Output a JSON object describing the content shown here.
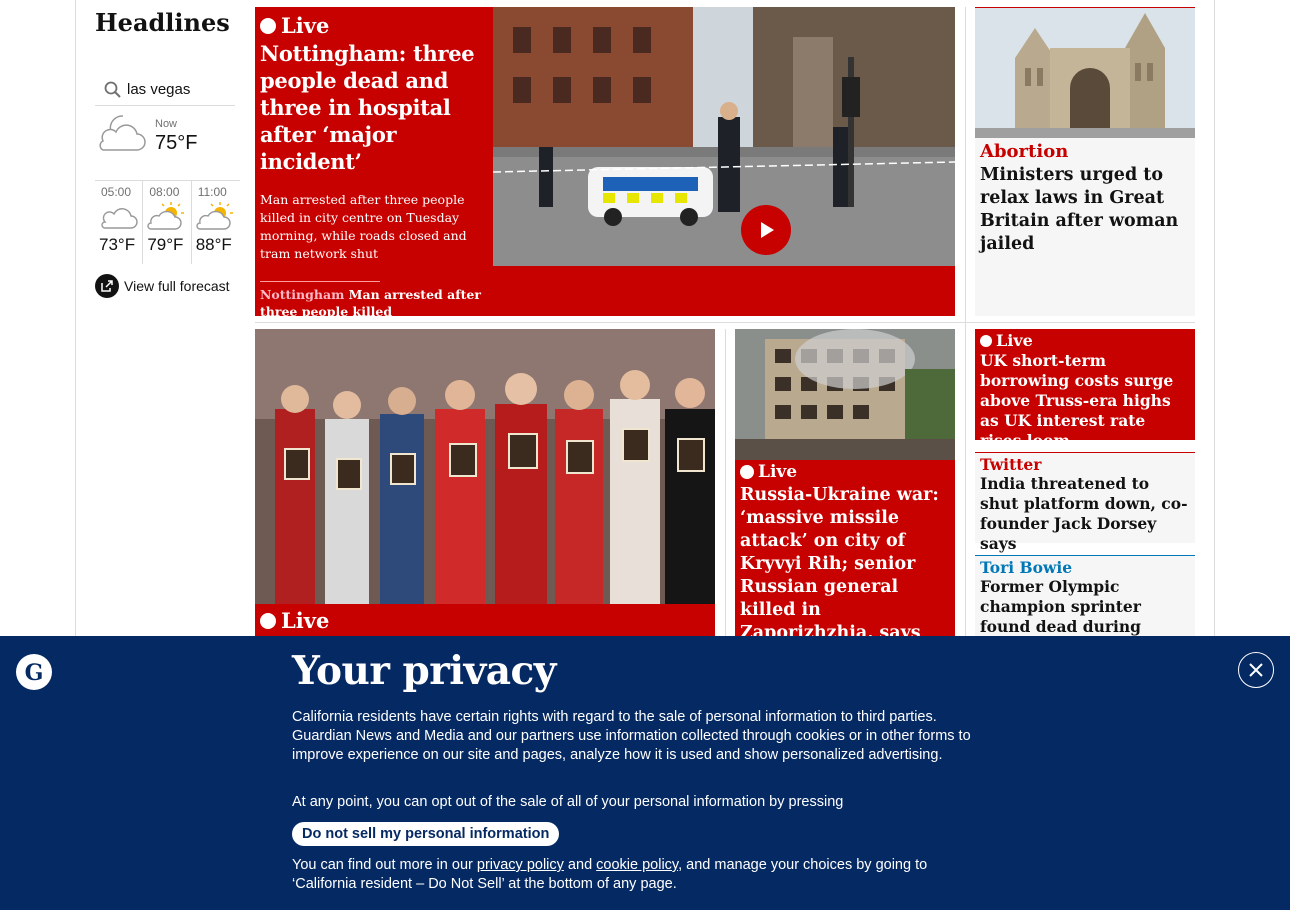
{
  "sidebar": {
    "title": "Headlines",
    "location": "las vegas",
    "now_label": "Now",
    "now_temp": "75°F",
    "forecast": [
      {
        "time": "05:00",
        "temp": "73°F",
        "icon": "cloud-icon"
      },
      {
        "time": "08:00",
        "temp": "79°F",
        "icon": "sun-cloud-icon"
      },
      {
        "time": "11:00",
        "temp": "88°F",
        "icon": "sun-cloud-icon"
      }
    ],
    "full_forecast": "View full forecast"
  },
  "lead": {
    "live": "Live",
    "headline": "Nottingham: three people dead and three in hospital after ‘major incident’",
    "standfirst": "Man arrested after three people killed in city centre on Tuesday morning, while roads closed and tram network shut",
    "sub_kicker": "Nottingham",
    "sub_text": "Man arrested after three people killed"
  },
  "court": {
    "kicker": "Abortion",
    "headline": "Ministers urged to relax laws in Great Britain after woman jailed"
  },
  "nurses": {
    "live": "Live"
  },
  "ukraine": {
    "live": "Live",
    "headline": "Russia-Ukraine war: ‘massive missile attack’ on city of Kryvyi Rih; senior Russian general killed in Zaporizhzhia, says Moscow"
  },
  "borrow": {
    "live": "Live",
    "headline": "UK short-term borrowing costs surge above Truss-era highs as UK interest rate rises loom"
  },
  "twitter": {
    "kicker": "Twitter",
    "headline": "India threatened to shut platform down, co-founder Jack Dorsey says"
  },
  "bowie": {
    "kicker": "Tori Bowie",
    "headline": "Former Olympic champion sprinter found dead during childbirth at home"
  },
  "privacy": {
    "title": "Your privacy",
    "p1": "California residents have certain rights with regard to the sale of personal information to third parties. Guardian News and Media and our partners use information collected through cookies or in other forms to improve experience on our site and pages, analyze how it is used and show personalized advertising.",
    "p2": "At any point, you can opt out of the sale of all of your personal information by pressing",
    "button": "Do not sell my personal information",
    "p3_a": "You can find out more in our ",
    "privacy_link": "privacy policy",
    "p3_b": " and ",
    "cookie_link": "cookie policy",
    "p3_c": ", and manage your choices by going to ‘California resident – Do Not Sell’ at the bottom of any page."
  },
  "colors": {
    "news_red": "#c70000",
    "banner_blue": "#052962",
    "sport_blue": "#0077b6"
  }
}
